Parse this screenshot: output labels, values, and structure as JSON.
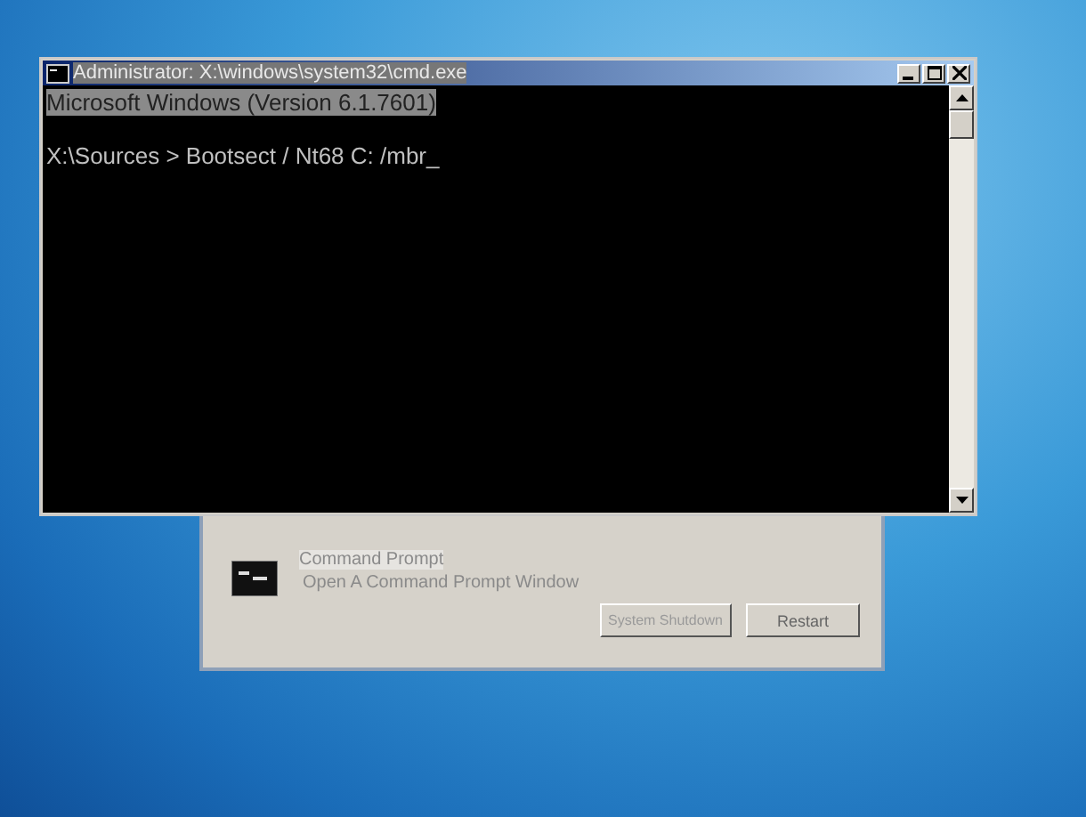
{
  "console_window": {
    "title": "Administrator: X:\\windows\\system32\\cmd.exe",
    "lines": [
      {
        "text": "Microsoft Windows (Version 6.1.7601)",
        "selected": true
      },
      {
        "text": "X:\\Sources > Bootsect / Nt68 C: /mbr_",
        "selected": false
      }
    ]
  },
  "recovery_dialog": {
    "option_title": "Command Prompt",
    "option_description": "Open A Command Prompt Window",
    "buttons": [
      {
        "label": "System Shutdown",
        "disabled": true
      },
      {
        "label": "Restart",
        "disabled": false
      }
    ]
  }
}
